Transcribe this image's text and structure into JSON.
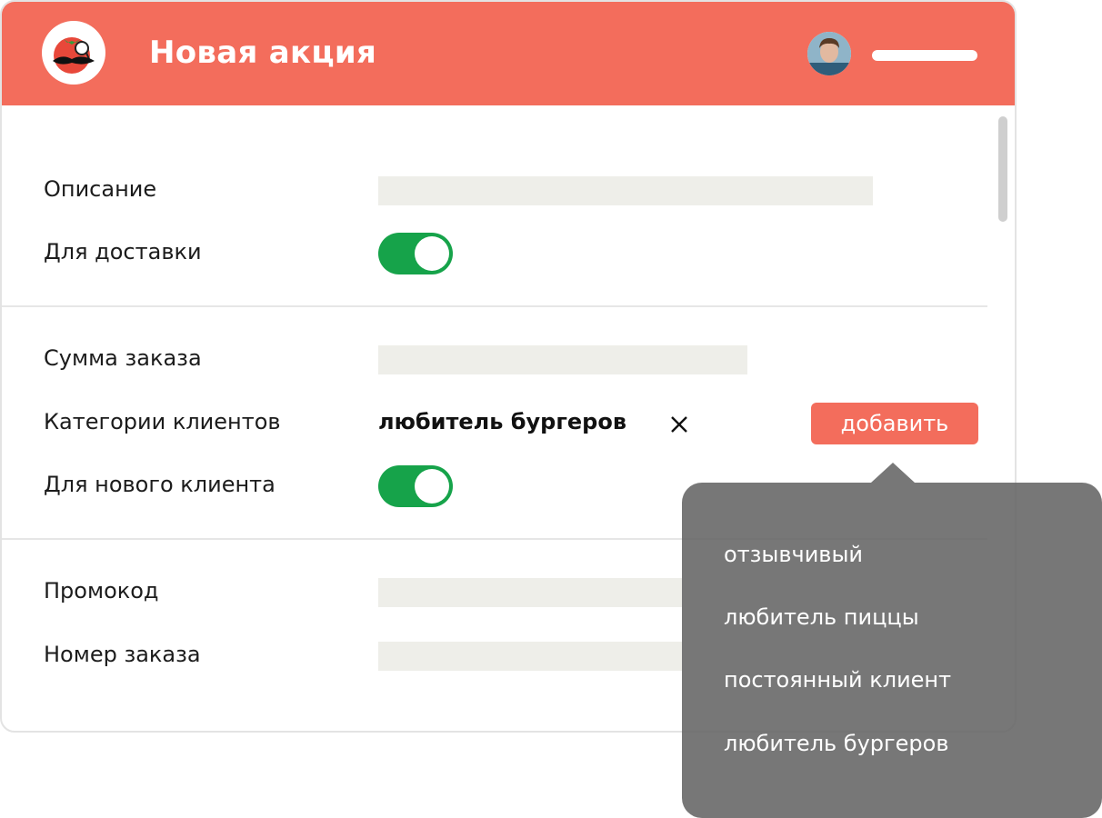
{
  "header": {
    "title": "Новая акция",
    "logo_icon": "tomato-mustache-logo",
    "avatar_icon": "user-avatar",
    "menu_icon": "menu-bar-icon",
    "color": "#f36d5c"
  },
  "form": {
    "description_label": "Описание",
    "delivery_label": "Для доставки",
    "delivery_enabled": true,
    "order_sum_label": "Сумма заказа",
    "categories_label": "Категории клиентов",
    "selected_category": "любитель бургеров",
    "add_button": "добавить",
    "new_client_label": "Для нового клиента",
    "new_client_enabled": true,
    "promo_label": "Промокод",
    "order_number_label": "Номер заказа"
  },
  "dropdown": {
    "options": [
      "отзывчивый",
      "любитель пиццы",
      "постоянный клиент",
      "любитель бургеров"
    ]
  },
  "colors": {
    "accent": "#f36d5c",
    "toggle_on": "#16a34a",
    "field_bg": "#eeeee9"
  }
}
